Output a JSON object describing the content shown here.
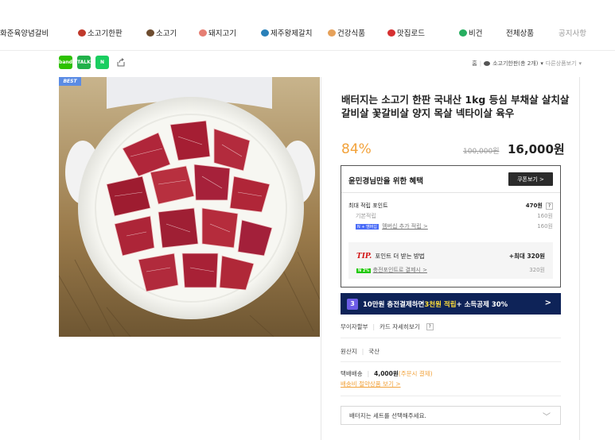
{
  "nav": {
    "items": [
      {
        "label": "화준육양념갈비",
        "icon": "none"
      },
      {
        "label": "소고기한판",
        "icon": "meat-icon",
        "color": "#c0392b"
      },
      {
        "label": "소고기",
        "icon": "cow-icon",
        "color": "#6d4c2f"
      },
      {
        "label": "돼지고기",
        "icon": "pig-icon",
        "color": "#e67e73"
      },
      {
        "label": "제주왕제갈치",
        "icon": "fish-icon",
        "color": "#2980b9"
      },
      {
        "label": "건강식품",
        "icon": "arm-icon",
        "color": "#e6a15a"
      },
      {
        "label": "맛집로드",
        "icon": "pin-icon",
        "color": "#d63031"
      },
      {
        "label": "비건",
        "icon": "veg-icon",
        "color": "#27ae60"
      },
      {
        "label": "전체상품",
        "icon": "none"
      },
      {
        "label": "공지사항",
        "icon": "none"
      }
    ]
  },
  "social": {
    "band": "band",
    "talk": "TALK",
    "n": "N",
    "share_icon": "share-icon"
  },
  "breadcrumb": {
    "home": "홈",
    "category": "소고기한판(총 2개)",
    "other": "다른상품보기"
  },
  "badge": {
    "best": "BEST"
  },
  "product": {
    "title": "배터지는 소고기 한판 국내산 1kg 등심 부채살 살치살 갈비살 꽃갈비살 양지 목살 넥타이살 육우",
    "discount": "84%",
    "original_price": "100,000원",
    "price": "16,000원"
  },
  "benefit": {
    "header": "윤민경님만을 위한 혜택",
    "coupon_button": "쿠폰보기 >",
    "max_points_label": "최대 적립 포인트",
    "max_points_value": "470원",
    "basic_label": "기본적립",
    "basic_value": "160원",
    "membership_badge": "N + 멤버십",
    "membership_label": "멤버십 추가 적립 >",
    "membership_value": "160원",
    "tip": "TIP.",
    "tip_label": "포인트 더 받는 방법",
    "tip_max": "+최대 320원",
    "charge_badge": "N 2%",
    "charge_label": "충전포인트로 결제시 >",
    "charge_value": "320원"
  },
  "banner": {
    "num": "3",
    "text_a": "10만원 충전결제하면 ",
    "text_hl": "3천원 적립",
    "text_b": " + 소득공제 30%",
    "arrow": ">"
  },
  "installment": {
    "label": "무이자할부",
    "link": "카드 자세히보기",
    "q": "?"
  },
  "origin": {
    "label": "원산지",
    "value": "국산"
  },
  "shipping": {
    "label": "택배배송",
    "price": "4,000원",
    "note": "(주문시 결제)",
    "link": "배송비 절약상품 보기 >"
  },
  "option": {
    "placeholder": "배터지는 세트를 선택해주세요."
  }
}
